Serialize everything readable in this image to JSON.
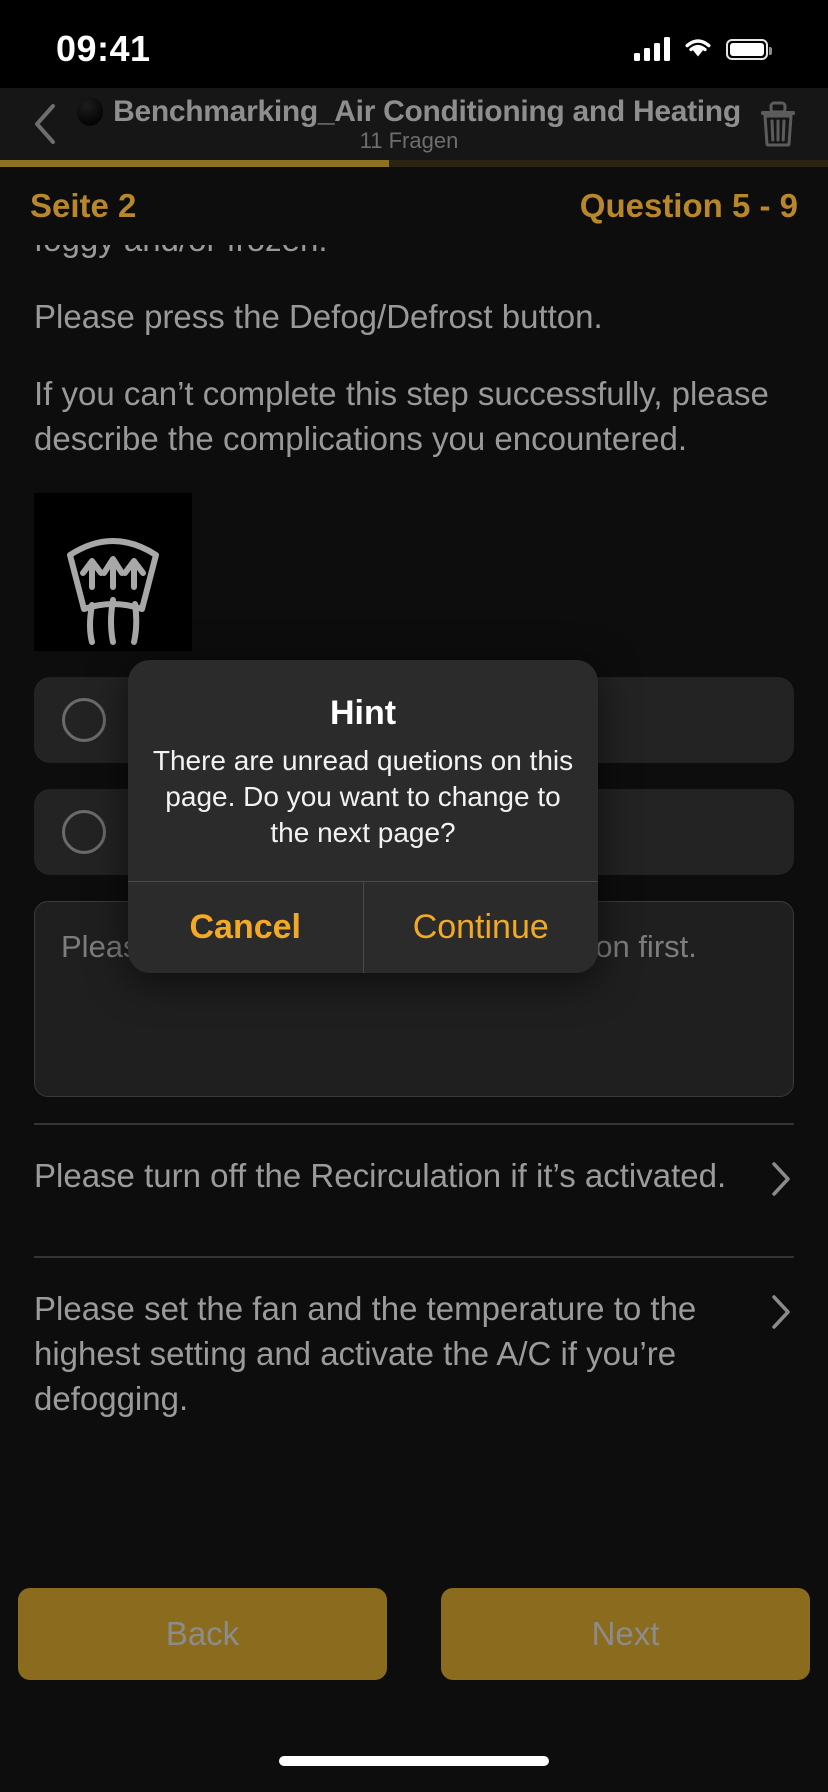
{
  "status_bar": {
    "time": "09:41",
    "cellular_icon": "cellular-signal-icon",
    "wifi_icon": "wifi-icon",
    "battery_icon": "battery-full-icon"
  },
  "header": {
    "back_icon": "chevron-left-icon",
    "avatar_icon": "survey-avatar-icon",
    "title": "Benchmarking_Air Conditioning and Heating",
    "subtitle": "11 Fragen",
    "delete_icon": "trash-icon"
  },
  "progress": {
    "percent": 47,
    "fill_color": "#8d7221",
    "track_color": "#2b2414"
  },
  "meta": {
    "page_label": "Seite 2",
    "question_range": "Question 5 - 9",
    "accent_color": "#b8862b"
  },
  "question": {
    "clipped_line": "foggy and/or frozen.",
    "paragraphs": [
      "Please press the Defog/Defrost button.",
      "If you can’t complete this step successfully, please describe the complications you encountered."
    ],
    "image_icon": "windshield-defrost-icon",
    "choices": [
      {
        "label": "O",
        "selected": false
      },
      {
        "label": "O",
        "selected": false
      }
    ],
    "answer_placeholder": "Please provide an answer to the question first."
  },
  "next_questions": [
    {
      "text": "Please turn off the Recirculation if it’s activated.",
      "chevron_icon": "chevron-right-icon"
    },
    {
      "text": "Please set the fan and the temperature to the highest setting and activate the A/C if you’re defogging.",
      "chevron_icon": "chevron-right-icon"
    }
  ],
  "footer": {
    "back_label": "Back",
    "next_label": "Next",
    "button_color": "#8b6c1e",
    "label_color": "#8c8c8c"
  },
  "modal": {
    "title": "Hint",
    "message": "There are unread quetions on this page. Do you want to change to the next page?",
    "cancel_label": "Cancel",
    "continue_label": "Continue",
    "accent_color": "#f2a926"
  }
}
